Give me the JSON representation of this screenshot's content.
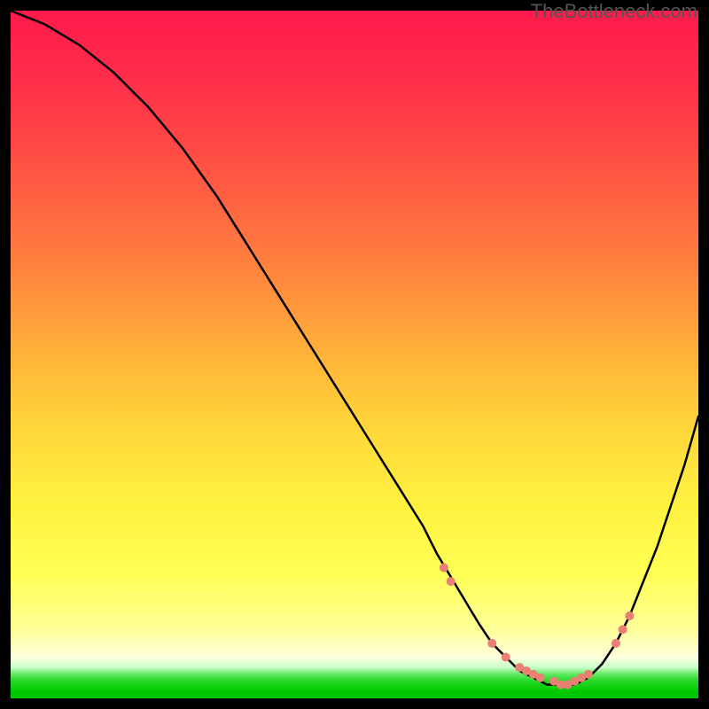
{
  "watermark": "TheBottleneck.com",
  "chart_data": {
    "type": "line",
    "title": "",
    "xlabel": "",
    "ylabel": "",
    "xlim": [
      0,
      100
    ],
    "ylim": [
      0,
      100
    ],
    "grid": false,
    "series": [
      {
        "name": "bottleneck-curve",
        "x": [
          0,
          5,
          10,
          15,
          20,
          25,
          30,
          35,
          40,
          45,
          50,
          55,
          60,
          62,
          65,
          68,
          70,
          72,
          74,
          76,
          78,
          80,
          82,
          84,
          86,
          88,
          90,
          92,
          94,
          96,
          98,
          100
        ],
        "y": [
          100,
          98,
          95,
          91,
          86,
          80,
          73,
          65,
          57,
          49,
          41,
          33,
          25,
          21,
          16,
          11,
          8,
          6,
          4,
          3,
          2,
          2,
          2,
          3,
          5,
          8,
          12,
          17,
          22,
          28,
          34,
          41
        ],
        "color": "#000000"
      }
    ],
    "highlight_points": {
      "name": "bottleneck-dots",
      "color": "#e88074",
      "points": [
        {
          "x": 63,
          "y": 19
        },
        {
          "x": 64,
          "y": 17
        },
        {
          "x": 70,
          "y": 8
        },
        {
          "x": 72,
          "y": 6
        },
        {
          "x": 74,
          "y": 4.5
        },
        {
          "x": 75,
          "y": 4
        },
        {
          "x": 76,
          "y": 3.5
        },
        {
          "x": 77,
          "y": 3
        },
        {
          "x": 79,
          "y": 2.5
        },
        {
          "x": 80,
          "y": 2
        },
        {
          "x": 81,
          "y": 2
        },
        {
          "x": 82,
          "y": 2.5
        },
        {
          "x": 83,
          "y": 3
        },
        {
          "x": 84,
          "y": 3.5
        },
        {
          "x": 88,
          "y": 8
        },
        {
          "x": 89,
          "y": 10
        },
        {
          "x": 90,
          "y": 12
        }
      ]
    },
    "background_gradient": {
      "stops": [
        {
          "offset": 0.0,
          "color": "#ff1a4d"
        },
        {
          "offset": 0.1,
          "color": "#ff2e4a"
        },
        {
          "offset": 0.2,
          "color": "#ff4a45"
        },
        {
          "offset": 0.35,
          "color": "#ff7a3f"
        },
        {
          "offset": 0.5,
          "color": "#ffb23a"
        },
        {
          "offset": 0.6,
          "color": "#ffd43a"
        },
        {
          "offset": 0.72,
          "color": "#fff23f"
        },
        {
          "offset": 0.82,
          "color": "#ffff55"
        },
        {
          "offset": 0.9,
          "color": "#ffff99"
        },
        {
          "offset": 0.94,
          "color": "#ffffdd"
        },
        {
          "offset": 0.955,
          "color": "#c8ffc8"
        },
        {
          "offset": 0.965,
          "color": "#5fe85f"
        },
        {
          "offset": 0.975,
          "color": "#26d926"
        },
        {
          "offset": 0.99,
          "color": "#00c800"
        },
        {
          "offset": 1.0,
          "color": "#00c800"
        }
      ]
    }
  }
}
